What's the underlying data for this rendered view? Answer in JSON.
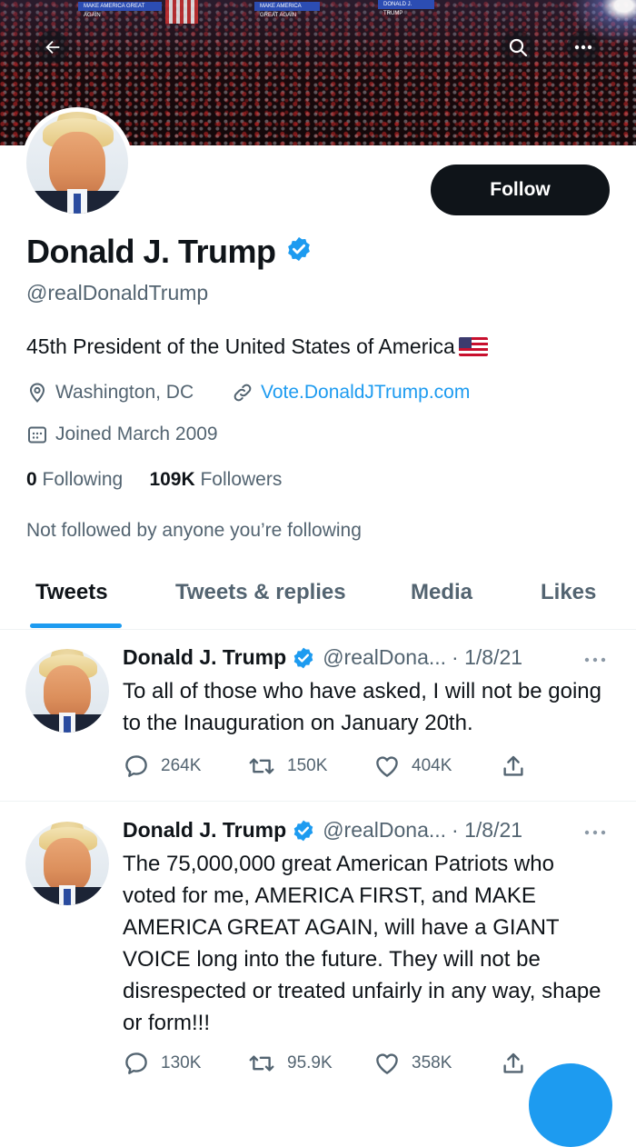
{
  "profile": {
    "name": "Donald J. Trump",
    "handle": "@realDonaldTrump",
    "bio": "45th President of the United States of America",
    "location": "Washington, DC",
    "website": "Vote.DonaldJTrump.com",
    "joined": "Joined March 2009",
    "following_count": "0",
    "following_label": "Following",
    "followers_count": "109K",
    "followers_label": "Followers",
    "not_followed": "Not followed by anyone you’re following",
    "follow_button": "Follow"
  },
  "banner": {
    "signs": [
      "MAKE AMERICA GREAT AGAIN",
      "MAKE AMERICA GREAT AGAIN",
      "DONALD J. TRUMP"
    ]
  },
  "tabs": [
    {
      "label": "Tweets",
      "active": true
    },
    {
      "label": "Tweets & replies",
      "active": false
    },
    {
      "label": "Media",
      "active": false
    },
    {
      "label": "Likes",
      "active": false
    }
  ],
  "tweets": [
    {
      "name": "Donald J. Trump",
      "handle": "@realDona...",
      "date": "· 1/8/21",
      "text": "To all of those who have asked, I will not be going to the Inauguration on January 20th.",
      "replies": "264K",
      "retweets": "150K",
      "likes": "404K"
    },
    {
      "name": "Donald J. Trump",
      "handle": "@realDona...",
      "date": "· 1/8/21",
      "text": "The 75,000,000 great American Patriots who voted for me, AMERICA FIRST, and MAKE AMERICA GREAT AGAIN, will have a GIANT VOICE long into the future. They will not be disrespected or treated unfairly in any way, shape or form!!!",
      "replies": "130K",
      "retweets": "95.9K",
      "likes": "358K"
    }
  ],
  "colors": {
    "accent": "#1d9bf0",
    "text": "#0f1419",
    "secondary": "#536471",
    "follow_bg": "#0f1419"
  },
  "icons": {
    "back": "back-arrow-icon",
    "search": "search-icon",
    "more": "more-icon",
    "verified": "verified-badge-icon",
    "location": "location-pin-icon",
    "link": "link-icon",
    "calendar": "calendar-icon",
    "reply": "reply-icon",
    "retweet": "retweet-icon",
    "like": "like-icon",
    "share": "share-icon"
  }
}
